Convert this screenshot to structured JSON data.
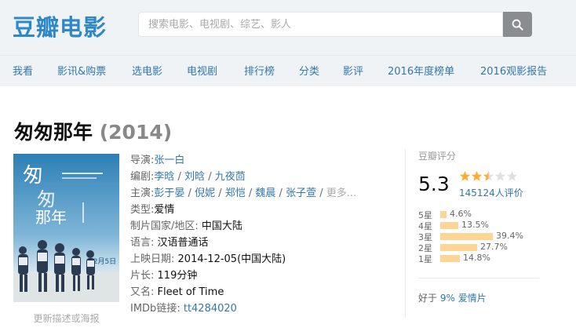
{
  "header": {
    "logo": "豆瓣电影",
    "search_placeholder": "搜索电影、电视剧、综艺、影人",
    "search_icon": "search-icon"
  },
  "nav": [
    "我看",
    "影讯&购票",
    "选电影",
    "电视剧",
    "排行榜",
    "分类",
    "影评",
    "2016年度榜单",
    "2016观影报告"
  ],
  "movie": {
    "title": "匆匆那年",
    "year": "(2014)",
    "poster": {
      "title_glyph_1": "匆",
      "title_glyph_2": "那年",
      "title_glyph_3": "匆",
      "date": "12月5日"
    },
    "poster_caption": "更新描述或海报"
  },
  "info": {
    "director_label": "导演:",
    "director": "张一白",
    "writer_label": "编剧:",
    "writers": [
      "李晗",
      "刘晗",
      "九夜茴"
    ],
    "cast_label": "主演:",
    "cast": [
      "彭于晏",
      "倪妮",
      "郑恺",
      "魏晨",
      "张子萱"
    ],
    "cast_more": "更多...",
    "genre_label": "类型:",
    "genre": "爱情",
    "region_label": "制片国家/地区:",
    "region": "中国大陆",
    "language_label": "语言:",
    "language": "汉语普通话",
    "release_label": "上映日期:",
    "release": "2014-12-05(中国大陆)",
    "runtime_label": "片长:",
    "runtime": "119分钟",
    "aka_label": "又名:",
    "aka": "Fleet of Time",
    "imdb_label": "IMDb链接:",
    "imdb": "tt4284020",
    "separator": " / "
  },
  "rating": {
    "label": "豆瓣评分",
    "score": "5.3",
    "stars_value": 2.5,
    "stars_max": 5,
    "star_color": "#ffac2d",
    "votes": "145124人评价",
    "distribution": [
      {
        "label": "5星",
        "pct": "4.6%",
        "value": 4.6
      },
      {
        "label": "4星",
        "pct": "13.5%",
        "value": 13.5
      },
      {
        "label": "3星",
        "pct": "39.4%",
        "value": 39.4
      },
      {
        "label": "2星",
        "pct": "27.7%",
        "value": 27.7
      },
      {
        "label": "1星",
        "pct": "14.8%",
        "value": 14.8
      }
    ],
    "better_prefix": "好于",
    "better_pct": "9%",
    "better_genre": "爱情片"
  }
}
